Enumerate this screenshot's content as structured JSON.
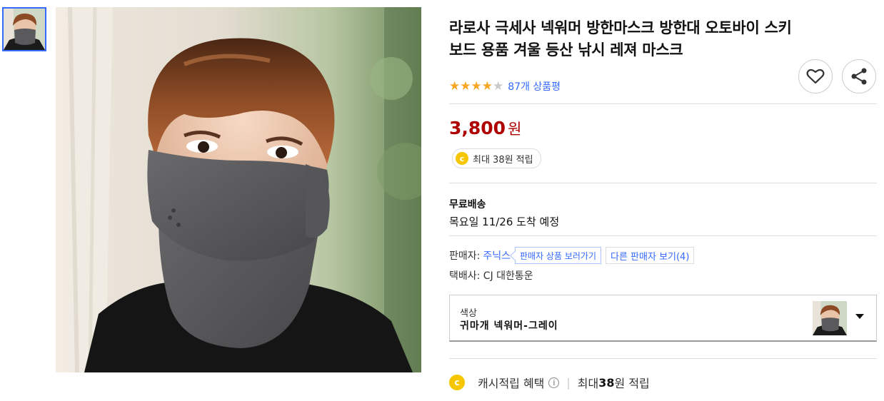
{
  "product": {
    "title": "라로사 극세사 넥워머 방한마스크 방한대 오토바이 스키 보드 용품 겨울 등산 낚시 레져 마스크",
    "rating_stars": 4,
    "rating_max": 5,
    "review_count": "87개 상품평"
  },
  "price": {
    "amount": "3,800",
    "currency": "원"
  },
  "cash_reward": {
    "coin": "c",
    "text": "최대 38원 적립"
  },
  "shipping": {
    "title": "무료배송",
    "date": "목요일 11/26 도착 예정"
  },
  "seller": {
    "label": "판매자:",
    "name": "주닉스",
    "shop_button": "판매자 상품 보러가기",
    "others_button": "다른 판매자 보기(4)"
  },
  "courier": {
    "text": "택배사: CJ 대한통운"
  },
  "option": {
    "label": "색상",
    "value": "귀마개 넥워머-그레이"
  },
  "benefit": {
    "coin": "c",
    "label": "캐시적립 혜택",
    "info": "i",
    "separator": "|",
    "prefix": "최대 ",
    "amount": "38",
    "suffix": "원 적립"
  },
  "icons": {
    "wishlist": "heart-icon",
    "share": "share-icon"
  }
}
